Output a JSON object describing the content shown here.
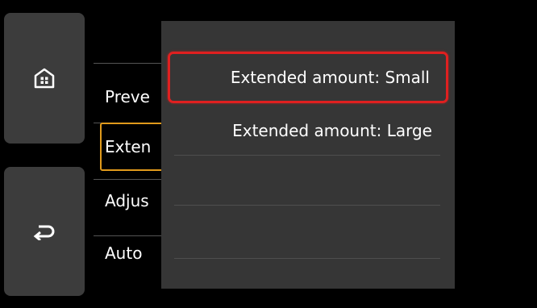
{
  "sidebar": {
    "home_icon": "home-icon",
    "back_icon": "back-arrow-icon"
  },
  "background_list": {
    "items": [
      {
        "label": "Preview"
      },
      {
        "label": "Extended copy amount"
      },
      {
        "label": "Adjust"
      },
      {
        "label": "Auto"
      }
    ],
    "visible_fragments": [
      "Preve",
      "Exten",
      "Adjus",
      "Auto"
    ]
  },
  "dropdown": {
    "options": [
      {
        "label": "Extended amount: Small",
        "selected": true
      },
      {
        "label": "Extended amount: Large",
        "selected": false
      },
      {
        "label": ""
      },
      {
        "label": ""
      }
    ]
  },
  "colors": {
    "background": "#000000",
    "panel": "#363636",
    "side_button": "#3c3c3c",
    "selection_outline": "#e09a1c",
    "highlight_outline": "#e02020"
  }
}
